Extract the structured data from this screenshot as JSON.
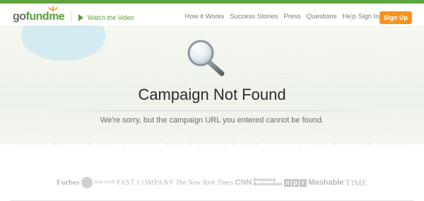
{
  "header": {
    "logo": {
      "go": "go",
      "fund": "fund",
      "me": "me"
    },
    "watch_video": "Watch the Video",
    "nav": [
      {
        "label": "How it Works"
      },
      {
        "label": "Success Stories"
      },
      {
        "label": "Press"
      },
      {
        "label": "Questions"
      },
      {
        "label": "Help"
      }
    ],
    "sign_in": "Sign In",
    "sign_up": "Sign Up"
  },
  "main": {
    "title": "Campaign Not Found",
    "message": "We're sorry, but the campaign URL you entered cannot be found."
  },
  "press": {
    "forbes": "Forbes",
    "seal_text": "SEAL GOOD",
    "fast_company": "FAST COMPANY",
    "nyt": "The New York Times",
    "cnn": "CNN",
    "bloomberg_1": "Bloomberg",
    "bloomberg_2": "Businessweek",
    "npr": [
      "n",
      "p",
      "r"
    ],
    "mashable": "Mashable",
    "time": "TIME"
  },
  "colors": {
    "brand_green": "#5a9e3a",
    "top_bar": "#5fa43f",
    "sign_up_orange": "#f7931e",
    "cloud": "#d4ebf1"
  },
  "icons": {
    "magnifier": "magnifying-glass-icon",
    "play": "play-icon"
  }
}
